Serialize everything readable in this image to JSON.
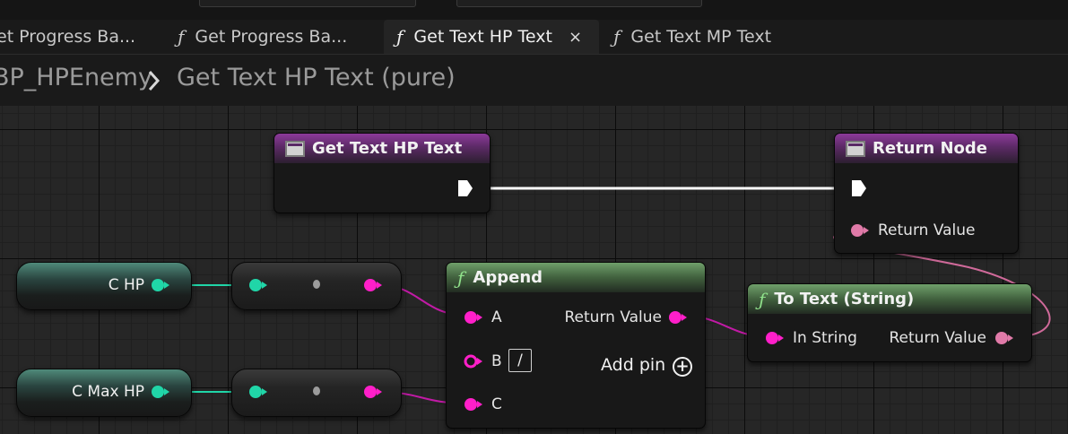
{
  "tabs": [
    {
      "label": "et Progress Ba...",
      "icon": "function-icon",
      "active": false
    },
    {
      "label": "Get Progress Ba...",
      "icon": "function-icon",
      "active": false
    },
    {
      "label": "Get Text HP Text",
      "icon": "function-icon",
      "active": true,
      "close": "×"
    },
    {
      "label": "Get Text MP Text",
      "icon": "function-icon",
      "active": false
    }
  ],
  "function_glyph": "ƒ",
  "breadcrumb": {
    "parent": "BP_HPEnemy",
    "separator": "chevron-right-icon",
    "current": "Get Text HP Text (pure)"
  },
  "nodes": {
    "entry": {
      "title": "Get Text HP Text"
    },
    "return": {
      "title": "Return Node",
      "pin_label": "Return Value"
    },
    "append": {
      "title": "Append",
      "pin_a": "A",
      "pin_b": "B",
      "pin_b_value": "/",
      "pin_c": "C",
      "output": "Return Value",
      "add_pin": "Add pin"
    },
    "to_text": {
      "title": "To Text (String)",
      "input": "In String",
      "output": "Return Value"
    }
  },
  "variables": [
    {
      "label": "C HP"
    },
    {
      "label": "C Max HP"
    }
  ],
  "colors": {
    "string_pin": "#ff1fc9",
    "int_pin": "#20d6a8",
    "text_pin": "#e07aa8",
    "exec_pin": "#ffffff",
    "pure_header": "#5a8a55",
    "event_header": "#7a3a8a"
  }
}
